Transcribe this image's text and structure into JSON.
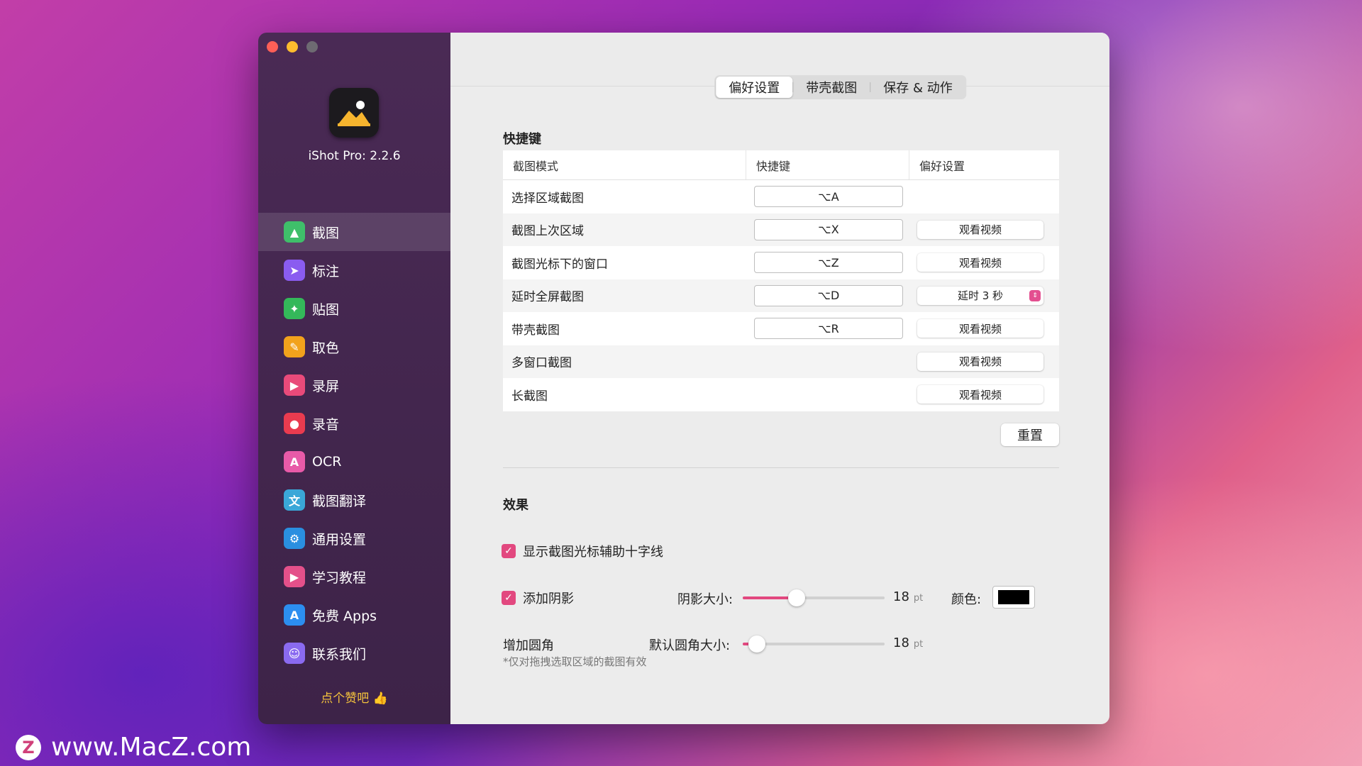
{
  "app": {
    "version_label": "iShot Pro: 2.2.6",
    "like_label": "点个赞吧 👍"
  },
  "sidebar": {
    "items": [
      {
        "label": "截图",
        "icon": "image-icon",
        "color": "#3fbf6a",
        "glyph": "▲",
        "active": true
      },
      {
        "label": "标注",
        "icon": "cursor-icon",
        "color": "#8a5cf0",
        "glyph": "➤"
      },
      {
        "label": "贴图",
        "icon": "pin-icon",
        "color": "#34b85a",
        "glyph": "✦"
      },
      {
        "label": "取色",
        "icon": "eyedropper-icon",
        "color": "#f2a21c",
        "glyph": "✎"
      },
      {
        "label": "录屏",
        "icon": "video-icon",
        "color": "#e94a7a",
        "glyph": "▶"
      },
      {
        "label": "录音",
        "icon": "microphone-icon",
        "color": "#ea3b4f",
        "glyph": "●"
      },
      {
        "label": "OCR",
        "icon": "ocr-icon",
        "color": "#e85aa8",
        "glyph": "A"
      },
      {
        "label": "截图翻译",
        "icon": "translate-icon",
        "color": "#3aa7d8",
        "glyph": "文"
      },
      {
        "label": "通用设置",
        "icon": "gear-icon",
        "color": "#2a8fe0",
        "glyph": "⚙"
      },
      {
        "label": "学习教程",
        "icon": "tutorial-icon",
        "color": "#e4508a",
        "glyph": "▶"
      },
      {
        "label": "免费 Apps",
        "icon": "appstore-icon",
        "color": "#2c8ef0",
        "glyph": "A"
      },
      {
        "label": "联系我们",
        "icon": "contacts-icon",
        "color": "#8a6af0",
        "glyph": "☺"
      }
    ]
  },
  "tabs": [
    {
      "label": "偏好设置",
      "active": true
    },
    {
      "label": "带壳截图"
    },
    {
      "label": "保存 & 动作"
    }
  ],
  "shortcuts": {
    "title": "快捷键",
    "headers": [
      "截图模式",
      "快捷键",
      "偏好设置"
    ],
    "rows": [
      {
        "mode": "选择区域截图",
        "key": "⌥A",
        "pref": ""
      },
      {
        "mode": "截图上次区域",
        "key": "⌥X",
        "pref": "观看视频"
      },
      {
        "mode": "截图光标下的窗口",
        "key": "⌥Z",
        "pref": "观看视频"
      },
      {
        "mode": "延时全屏截图",
        "key": "⌥D",
        "pref": "延时 3 秒",
        "select": true
      },
      {
        "mode": "带壳截图",
        "key": "⌥R",
        "pref": "观看视频"
      },
      {
        "mode": "多窗口截图",
        "key": "",
        "pref": "观看视频"
      },
      {
        "mode": "长截图",
        "key": "",
        "pref": "观看视频"
      }
    ],
    "reset_label": "重置"
  },
  "effects": {
    "title": "效果",
    "crosshair_label": "显示截图光标辅助十字线",
    "crosshair_checked": true,
    "shadow_label": "添加阴影",
    "shadow_checked": true,
    "shadow_size_label": "阴影大小:",
    "shadow_size_value": "18",
    "shadow_size_fraction": 0.38,
    "unit": "pt",
    "color_label": "颜色:",
    "shadow_color": "#000000",
    "corner_label": "增加圆角",
    "corner_size_label": "默认圆角大小:",
    "corner_size_value": "18",
    "corner_size_fraction": 0.1,
    "note": "*仅对拖拽选取区域的截图有效"
  },
  "watermark": {
    "logo": "Z",
    "text": "www.MacZ.com"
  }
}
